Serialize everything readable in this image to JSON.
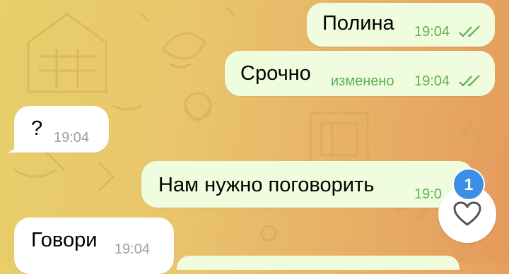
{
  "messages": [
    {
      "direction": "out",
      "text": "Полина",
      "time": "19:04",
      "edited_label": "",
      "read": true
    },
    {
      "direction": "out",
      "text": "Срочно",
      "time": "19:04",
      "edited_label": "изменено",
      "read": true
    },
    {
      "direction": "in",
      "text": "?",
      "time": "19:04"
    },
    {
      "direction": "out",
      "text": "Нам нужно поговорить",
      "time": "19:0"
    },
    {
      "direction": "in",
      "text": "Говори",
      "time": "19:04"
    }
  ],
  "reaction": {
    "count": "1",
    "icon": "heart-outline-icon"
  },
  "colors": {
    "outgoing_bubble": "#effdde",
    "incoming_bubble": "#ffffff",
    "time_out": "#5fae52",
    "badge": "#3a8ee6"
  }
}
